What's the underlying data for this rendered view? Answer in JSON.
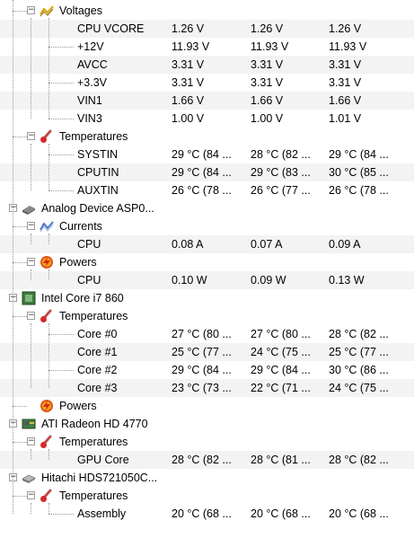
{
  "tree": [
    {
      "type": "group",
      "level": 1,
      "icon": "voltage-icon",
      "label": "Voltages"
    },
    {
      "type": "value",
      "name": "CPU VCORE",
      "v1": "1.26 V",
      "v2": "1.26 V",
      "v3": "1.26 V"
    },
    {
      "type": "value",
      "name": "+12V",
      "v1": "11.93 V",
      "v2": "11.93 V",
      "v3": "11.93 V"
    },
    {
      "type": "value",
      "name": "AVCC",
      "v1": "3.31 V",
      "v2": "3.31 V",
      "v3": "3.31 V"
    },
    {
      "type": "value",
      "name": "+3.3V",
      "v1": "3.31 V",
      "v2": "3.31 V",
      "v3": "3.31 V"
    },
    {
      "type": "value",
      "name": "VIN1",
      "v1": "1.66 V",
      "v2": "1.66 V",
      "v3": "1.66 V"
    },
    {
      "type": "value",
      "name": "VIN3",
      "v1": "1.00 V",
      "v2": "1.00 V",
      "v3": "1.01 V"
    },
    {
      "type": "group",
      "level": 1,
      "icon": "thermometer-icon",
      "label": "Temperatures"
    },
    {
      "type": "value",
      "name": "SYSTIN",
      "v1": "29 °C  (84 ...",
      "v2": "28 °C  (82 ...",
      "v3": "29 °C  (84 ..."
    },
    {
      "type": "value",
      "name": "CPUTIN",
      "v1": "29 °C  (84 ...",
      "v2": "29 °C  (83 ...",
      "v3": "30 °C  (85 ..."
    },
    {
      "type": "value",
      "name": "AUXTIN",
      "v1": "26 °C  (78 ...",
      "v2": "26 °C  (77 ...",
      "v3": "26 °C  (78 ..."
    },
    {
      "type": "device",
      "icon": "chip-icon",
      "label": "Analog Device ASP0..."
    },
    {
      "type": "group",
      "level": 1,
      "icon": "current-icon",
      "label": "Currents"
    },
    {
      "type": "value",
      "name": "CPU",
      "v1": "0.08 A",
      "v2": "0.07 A",
      "v3": "0.09 A"
    },
    {
      "type": "group",
      "level": 1,
      "icon": "power-icon",
      "label": "Powers"
    },
    {
      "type": "value",
      "name": "CPU",
      "v1": "0.10 W",
      "v2": "0.09 W",
      "v3": "0.13 W"
    },
    {
      "type": "device",
      "icon": "cpu-icon",
      "label": "Intel Core i7 860"
    },
    {
      "type": "group",
      "level": 1,
      "icon": "thermometer-icon",
      "label": "Temperatures"
    },
    {
      "type": "value",
      "name": "Core #0",
      "v1": "27 °C  (80 ...",
      "v2": "27 °C  (80 ...",
      "v3": "28 °C  (82 ..."
    },
    {
      "type": "value",
      "name": "Core #1",
      "v1": "25 °C  (77 ...",
      "v2": "24 °C  (75 ...",
      "v3": "25 °C  (77 ..."
    },
    {
      "type": "value",
      "name": "Core #2",
      "v1": "29 °C  (84 ...",
      "v2": "29 °C  (84 ...",
      "v3": "30 °C  (86 ..."
    },
    {
      "type": "value",
      "name": "Core #3",
      "v1": "23 °C  (73 ...",
      "v2": "22 °C  (71 ...",
      "v3": "24 °C  (75 ..."
    },
    {
      "type": "group",
      "level": 1,
      "icon": "power-icon",
      "label": "Powers",
      "leaf": true
    },
    {
      "type": "device",
      "icon": "gpu-icon",
      "label": "ATI Radeon HD 4770"
    },
    {
      "type": "group",
      "level": 1,
      "icon": "thermometer-icon",
      "label": "Temperatures"
    },
    {
      "type": "value",
      "name": "GPU Core",
      "v1": "28 °C  (82 ...",
      "v2": "28 °C  (81 ...",
      "v3": "28 °C  (82 ..."
    },
    {
      "type": "device",
      "icon": "hdd-icon",
      "label": "Hitachi HDS721050C..."
    },
    {
      "type": "group",
      "level": 1,
      "icon": "thermometer-icon",
      "label": "Temperatures"
    },
    {
      "type": "value",
      "name": "Assembly",
      "v1": "20 °C  (68 ...",
      "v2": "20 °C  (68 ...",
      "v3": "20 °C  (68 ..."
    }
  ],
  "toggle_symbol": "−"
}
